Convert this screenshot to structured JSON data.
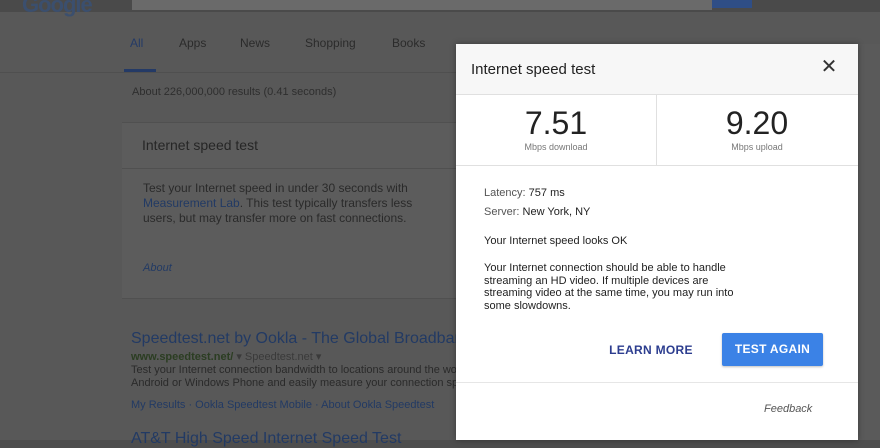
{
  "background_page": {
    "logo": "Google",
    "tabs": [
      "All",
      "Apps",
      "News",
      "Shopping",
      "Books"
    ],
    "result_stats": "About 226,000,000 results (0.41 seconds)",
    "card": {
      "title": "Internet speed test",
      "line1": "Test your Internet speed in under 30 seconds with",
      "line2_link": "Measurement Lab",
      "line2_rest": ". This test typically transfers less",
      "line3": "users, but may transfer more on fast connections.",
      "about": "About"
    },
    "result1": {
      "title": "Speedtest.net by Ookla - The Global Broadband Speed Test",
      "url": "www.speedtest.net/",
      "url_extra": "▾  Speedtest.net ▾",
      "snippet1": "Test your Internet connection bandwidth to locations around the world",
      "snippet2": "Android or Windows Phone and easily measure your connection speed",
      "links": "My Results · Ookla Speedtest Mobile · About Ookla Speedtest"
    },
    "result2": {
      "title": "AT&T High Speed Internet Speed Test"
    }
  },
  "modal": {
    "title": "Internet speed test",
    "close_glyph": "✕",
    "download": {
      "value": "7.51",
      "unit": "Mbps download"
    },
    "upload": {
      "value": "9.20",
      "unit": "Mbps upload"
    },
    "latency_label": "Latency:",
    "latency_value": "757 ms",
    "server_label": "Server:",
    "server_value": "New York, NY",
    "status": "Your Internet speed looks OK",
    "description": "Your Internet connection should be able to handle streaming an HD video. If multiple devices are streaming video at the same time, you may run into some slowdowns.",
    "learn_more": "LEARN MORE",
    "test_again": "TEST AGAIN",
    "feedback": "Feedback"
  },
  "colors": {
    "accent_button": "#3b82e6",
    "link_blue": "#2c3d8f",
    "overlay_dim": "#585858"
  }
}
